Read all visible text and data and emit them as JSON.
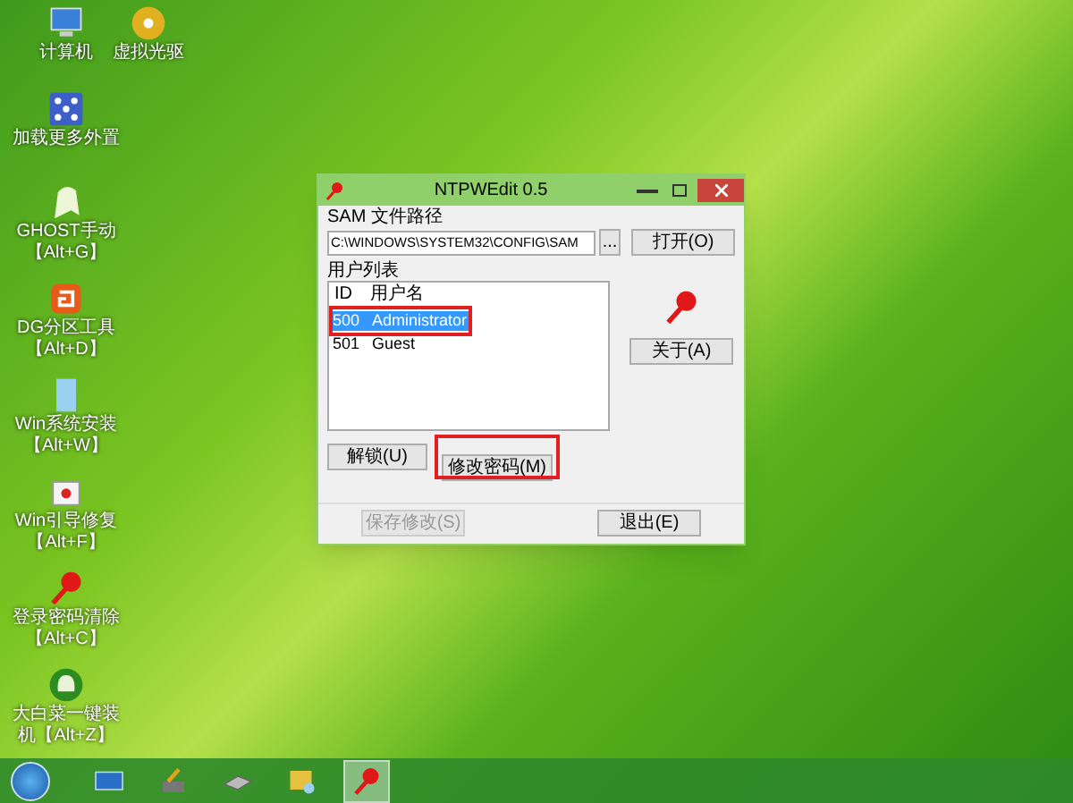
{
  "desktop_icons": [
    {
      "kind": "computer",
      "lines": [
        "计算机"
      ]
    },
    {
      "kind": "disc",
      "lines": [
        "虚拟光驱"
      ]
    },
    {
      "kind": "grid",
      "lines": [
        "加载更多外置"
      ]
    },
    {
      "kind": "ghost",
      "lines": [
        "GHOST手动",
        "【Alt+G】"
      ]
    },
    {
      "kind": "partition",
      "lines": [
        "DG分区工具",
        "【Alt+D】"
      ]
    },
    {
      "kind": "install",
      "lines": [
        "Win系统安装",
        "【Alt+W】"
      ]
    },
    {
      "kind": "repair",
      "lines": [
        "Win引导修复",
        "【Alt+F】"
      ]
    },
    {
      "kind": "ntkey",
      "lines": [
        "登录密码清除",
        "【Alt+C】"
      ]
    },
    {
      "kind": "cabbage",
      "lines": [
        "大白菜一键装",
        "机【Alt+Z】"
      ]
    }
  ],
  "window": {
    "title": "NTPWEdit 0.5",
    "sam_label": "SAM 文件路径",
    "sam_path": "C:\\WINDOWS\\SYSTEM32\\CONFIG\\SAM",
    "browse_button": "...",
    "open_button": "打开(O)",
    "user_list_label": "用户列表",
    "columns": [
      "ID",
      "用户名"
    ],
    "users": [
      {
        "id": "500",
        "name": "Administrator",
        "selected": true,
        "marked": true
      },
      {
        "id": "501",
        "name": "Guest",
        "selected": false,
        "marked": false
      }
    ],
    "about_button": "关于(A)",
    "unlock_button": "解锁(U)",
    "change_password_button": {
      "label": "修改密码(M)",
      "marked": true
    },
    "save_button": {
      "label": "保存修改(S)",
      "disabled": true
    },
    "exit_button": "退出(E)"
  },
  "taskbar": [
    {
      "kind": "monitor",
      "active": false
    },
    {
      "kind": "tools",
      "active": false
    },
    {
      "kind": "drive",
      "active": false
    },
    {
      "kind": "picture",
      "active": false
    },
    {
      "kind": "ntkey",
      "active": true
    }
  ]
}
